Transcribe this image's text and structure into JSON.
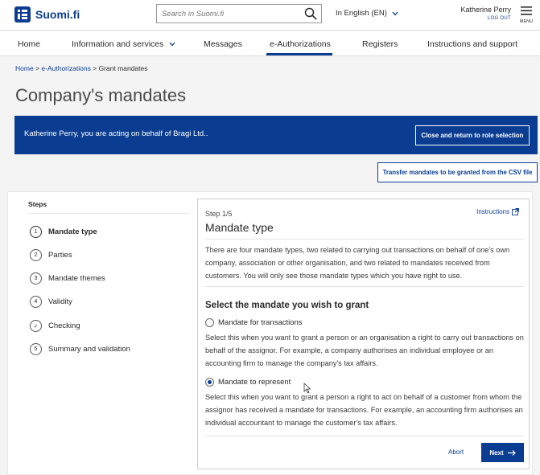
{
  "header": {
    "logo_text": "Suomi.fi",
    "search_placeholder": "Search in Suomi.fi",
    "language": "In English (EN)",
    "user_name": "Katherine Perry",
    "logout": "LOG OUT",
    "menu_label": "MENU"
  },
  "nav": {
    "items": [
      {
        "label": "Home"
      },
      {
        "label": "Information and services"
      },
      {
        "label": "Messages"
      },
      {
        "label": "e-Authorizations"
      },
      {
        "label": "Registers"
      },
      {
        "label": "Instructions and support"
      }
    ]
  },
  "breadcrumb": {
    "home": "Home",
    "sep": ">",
    "eauth": "e-Authorizations",
    "current": "Grant mandates"
  },
  "page_title": "Company's mandates",
  "banner": {
    "text": "Katherine Perry, you are acting on behalf of Bragi Ltd..",
    "button": "Close and return to role selection"
  },
  "csv_button": "Transfer mandates to be granted from the CSV file",
  "steps": {
    "title": "Steps",
    "items": [
      {
        "num": "1",
        "label": "Mandate type"
      },
      {
        "num": "2",
        "label": "Parties"
      },
      {
        "num": "3",
        "label": "Mandate themes"
      },
      {
        "num": "4",
        "label": "Validity"
      },
      {
        "num": "✓",
        "label": "Checking"
      },
      {
        "num": "5",
        "label": "Summary and validation"
      }
    ]
  },
  "card": {
    "step": "Step 1/5",
    "instructions": "Instructions",
    "title": "Mandate type",
    "intro": "There are four mandate types, two related to carrying out transactions on behalf of one's own company, association or other organisation, and two related to mandates received from customers. You will only see those mandate types which you have right to use.",
    "select_title": "Select the mandate you wish to grant",
    "options": [
      {
        "label": "Mandate for transactions",
        "desc": "Select this when you want to grant a person or an organisation a right to carry out transactions on behalf of the assignor. For example, a company authorises an individual employee or an accounting firm to manage the company's tax affairs.",
        "checked": false
      },
      {
        "label": "Mandate to represent",
        "desc": "Select this when you want to grant a person a right to act on behalf of a customer from whom the assignor has received a mandate for transactions. For example, an accounting firm authorises an individual accountant to manage the customer's tax affairs.",
        "checked": true
      }
    ],
    "abort": "Abort",
    "next": "Next"
  },
  "colors": {
    "brand": "#0a3d91"
  }
}
